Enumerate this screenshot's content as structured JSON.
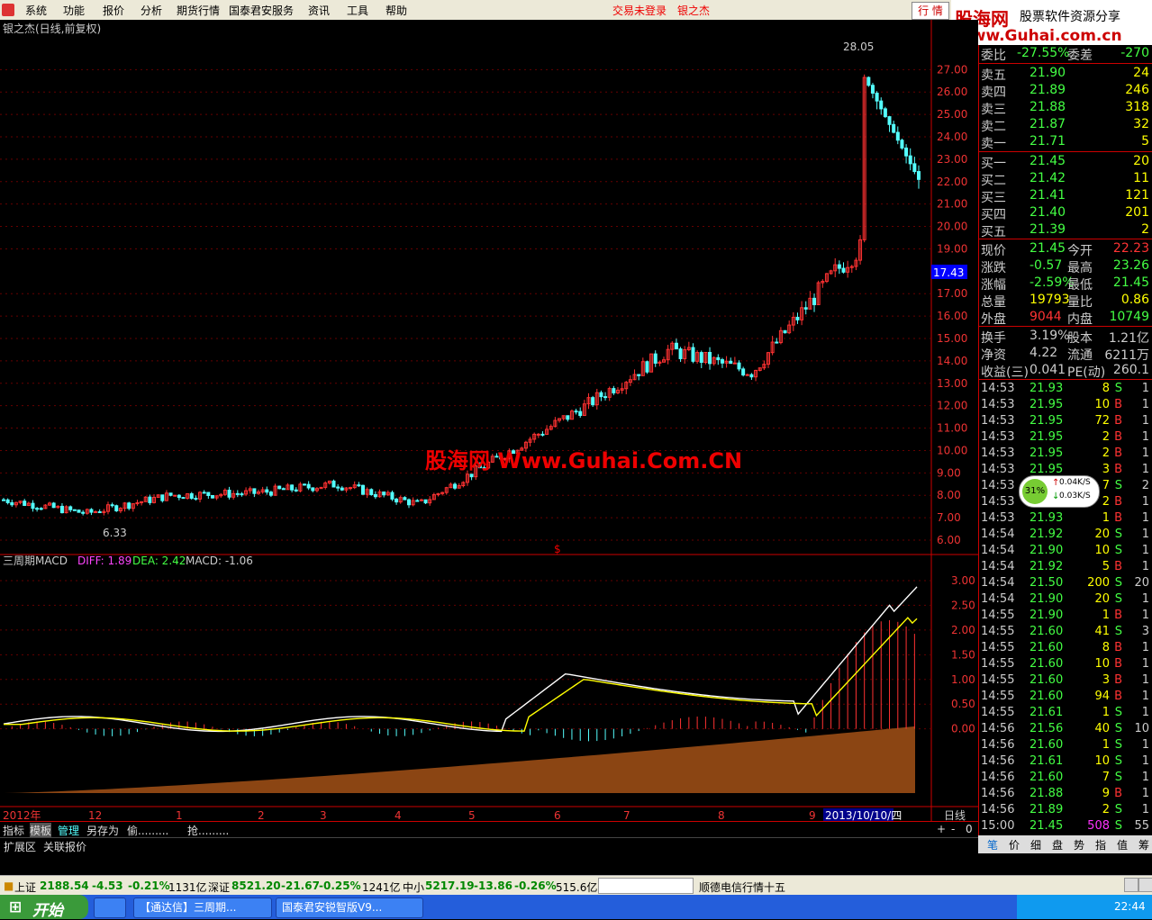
{
  "menubar": {
    "items": [
      "系统",
      "功能",
      "报价",
      "分析",
      "期货行情",
      "国泰君安服务",
      "资讯",
      "工具",
      "帮助"
    ],
    "status": "交易未登录",
    "stock_name": "银之杰",
    "trade_button": "行  情"
  },
  "brand": {
    "name": "股海网",
    "slogan": "股票软件资源分享",
    "url": "Www.Guhai.com.cn"
  },
  "chart": {
    "title": "银之杰(日线,前复权)",
    "watermark": "股海网 Www.Guhai.Com.CN",
    "high_label": "28.05",
    "low_label": "6.33",
    "current_price_tag": "17.43",
    "price_ticks": [
      "27.00",
      "26.00",
      "25.00",
      "24.00",
      "23.00",
      "22.00",
      "21.00",
      "20.00",
      "19.00",
      "17.00",
      "16.00",
      "15.00",
      "14.00",
      "13.00",
      "12.00",
      "11.00",
      "10.00",
      "9.00",
      "8.00",
      "7.00",
      "6.00"
    ],
    "macd_title": "三周期MACD",
    "diff": "DIFF: 1.89",
    "dea": "DEA: 2.42",
    "macd": "MACD: -1.06",
    "macd_ticks": [
      "3.00",
      "2.50",
      "2.00",
      "1.50",
      "1.00",
      "0.50",
      "0.00"
    ],
    "date_axis": [
      "2012年",
      "12",
      "1",
      "2",
      "3",
      "4",
      "5",
      "6",
      "7",
      "8",
      "9"
    ],
    "cursor_date": "2013/10/10/四",
    "period": "日线",
    "s_marker": "$"
  },
  "chart_data": {
    "type": "candlestick",
    "title": "银之杰(日线,前复权)",
    "ylim": [
      6,
      28.5
    ],
    "monthly_close": [
      {
        "month": "2012-11",
        "close": 7.8
      },
      {
        "month": "2012-12",
        "close": 7.2
      },
      {
        "month": "2013-01",
        "close": 8.0
      },
      {
        "month": "2013-02",
        "close": 8.1
      },
      {
        "month": "2013-03",
        "close": 8.5
      },
      {
        "month": "2013-04",
        "close": 7.6
      },
      {
        "month": "2013-05",
        "close": 9.8
      },
      {
        "month": "2013-06",
        "close": 12.0
      },
      {
        "month": "2013-07",
        "close": 14.5
      },
      {
        "month": "2013-08",
        "close": 13.5
      },
      {
        "month": "2013-09",
        "close": 18.0
      },
      {
        "month": "2013-10",
        "close": 21.45
      }
    ],
    "high": 28.05,
    "low": 6.33,
    "macd": {
      "diff": 1.89,
      "dea": 2.42,
      "macd": -1.06,
      "ylim": [
        -1.5,
        3.2
      ]
    }
  },
  "quote": {
    "weibi": {
      "label": "委比",
      "value": "-27.55%",
      "label2": "委差",
      "value2": "-270"
    },
    "sell": [
      {
        "label": "卖五",
        "price": "21.90",
        "vol": "24"
      },
      {
        "label": "卖四",
        "price": "21.89",
        "vol": "246"
      },
      {
        "label": "卖三",
        "price": "21.88",
        "vol": "318"
      },
      {
        "label": "卖二",
        "price": "21.87",
        "vol": "32"
      },
      {
        "label": "卖一",
        "price": "21.71",
        "vol": "5"
      }
    ],
    "buy": [
      {
        "label": "买一",
        "price": "21.45",
        "vol": "20"
      },
      {
        "label": "买二",
        "price": "21.42",
        "vol": "11"
      },
      {
        "label": "买三",
        "price": "21.41",
        "vol": "121"
      },
      {
        "label": "买四",
        "price": "21.40",
        "vol": "201"
      },
      {
        "label": "买五",
        "price": "21.39",
        "vol": "2"
      }
    ],
    "stats": [
      {
        "l1": "现价",
        "v1": "21.45",
        "l2": "今开",
        "v2": "22.23"
      },
      {
        "l1": "涨跌",
        "v1": "-0.57",
        "l2": "最高",
        "v2": "23.26"
      },
      {
        "l1": "涨幅",
        "v1": "-2.59%",
        "l2": "最低",
        "v2": "21.45"
      },
      {
        "l1": "总量",
        "v1": "19793",
        "l2": "量比",
        "v2": "0.86"
      },
      {
        "l1": "外盘",
        "v1": "9044",
        "l2": "内盘",
        "v2": "10749"
      }
    ],
    "stats2": [
      {
        "l1": "换手",
        "v1": "3.19%",
        "l2": "股本",
        "v2": "1.21亿"
      },
      {
        "l1": "净资",
        "v1": "4.22",
        "l2": "流通",
        "v2": "6211万"
      },
      {
        "l1": "收益(三)",
        "v1": "0.041",
        "l2": "PE(动)",
        "v2": "260.1"
      }
    ],
    "ticks": [
      [
        "14:53",
        "21.93",
        "8",
        "S",
        "1"
      ],
      [
        "14:53",
        "21.95",
        "10",
        "B",
        "1"
      ],
      [
        "14:53",
        "21.95",
        "72",
        "B",
        "1"
      ],
      [
        "14:53",
        "21.95",
        "2",
        "B",
        "1"
      ],
      [
        "14:53",
        "21.95",
        "2",
        "B",
        "1"
      ],
      [
        "14:53",
        "21.95",
        "3",
        "B",
        "1"
      ],
      [
        "14:53",
        "21.95",
        "7",
        "S",
        "2"
      ],
      [
        "14:53",
        "21.95",
        "2",
        "B",
        "1"
      ],
      [
        "14:53",
        "21.93",
        "1",
        "B",
        "1"
      ],
      [
        "14:54",
        "21.92",
        "20",
        "S",
        "1"
      ],
      [
        "14:54",
        "21.90",
        "10",
        "S",
        "1"
      ],
      [
        "14:54",
        "21.92",
        "5",
        "B",
        "1"
      ],
      [
        "14:54",
        "21.50",
        "200",
        "S",
        "20"
      ],
      [
        "14:54",
        "21.90",
        "20",
        "S",
        "1"
      ],
      [
        "14:55",
        "21.90",
        "1",
        "B",
        "1"
      ],
      [
        "14:55",
        "21.60",
        "41",
        "S",
        "3"
      ],
      [
        "14:55",
        "21.60",
        "8",
        "B",
        "1"
      ],
      [
        "14:55",
        "21.60",
        "10",
        "B",
        "1"
      ],
      [
        "14:55",
        "21.60",
        "3",
        "B",
        "1"
      ],
      [
        "14:55",
        "21.60",
        "94",
        "B",
        "1"
      ],
      [
        "14:55",
        "21.61",
        "1",
        "S",
        "1"
      ],
      [
        "14:56",
        "21.56",
        "40",
        "S",
        "10"
      ],
      [
        "14:56",
        "21.60",
        "1",
        "S",
        "1"
      ],
      [
        "14:56",
        "21.61",
        "10",
        "S",
        "1"
      ],
      [
        "14:56",
        "21.60",
        "7",
        "S",
        "1"
      ],
      [
        "14:56",
        "21.88",
        "9",
        "B",
        "1"
      ],
      [
        "14:56",
        "21.89",
        "2",
        "S",
        "1"
      ],
      [
        "15:00",
        "21.45",
        "508",
        "S",
        "55"
      ]
    ],
    "bottom_tabs": [
      "笔",
      "价",
      "细",
      "盘",
      "势",
      "指",
      "值",
      "筹"
    ]
  },
  "speed_bubble": {
    "percent": "31%",
    "up": "0.04K/S",
    "down": "0.03K/S"
  },
  "toolbar": {
    "items": [
      "指标",
      "模板",
      "管理",
      "另存为",
      "偷.........",
      "抢........."
    ],
    "row2": [
      "扩展区",
      "关联报价"
    ],
    "buttons": [
      "+",
      "-",
      "0"
    ]
  },
  "statusbar": {
    "sh": {
      "name": "上证",
      "value": "2188.54",
      "chg": "-4.53",
      "pct": "-0.21%",
      "amt": "1131亿"
    },
    "sz": {
      "name": "深证",
      "value": "8521.20",
      "chg": "-21.67",
      "pct": "-0.25%",
      "amt": "1241亿"
    },
    "zx": {
      "name": "中小",
      "value": "5217.19",
      "chg": "-13.86",
      "pct": "-0.26%",
      "amt": "515.6亿"
    },
    "news": "顺德电信行情十五"
  },
  "taskbar": {
    "start": "开始",
    "tasks": [
      "【通达信】三周期...",
      "国泰君安锐智版V9..."
    ],
    "clock": "22:44"
  },
  "colors": {
    "up": "#ff3232",
    "down": "#54ffff",
    "diff": "#ffffff",
    "dea": "#ffff00",
    "grid": "#800000"
  }
}
